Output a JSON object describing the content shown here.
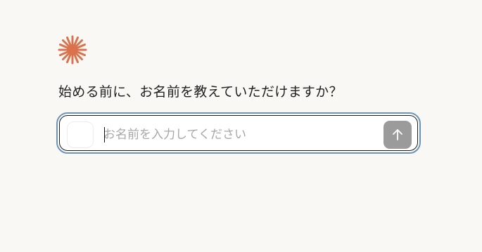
{
  "logo": {
    "icon": "asterisk-burst-icon",
    "color": "#d9734e"
  },
  "prompt": {
    "text": "始める前に、お名前を教えていただけますか？"
  },
  "name_input": {
    "placeholder": "お名前を入力してください",
    "value": ""
  },
  "send_button": {
    "icon": "arrow-up-icon",
    "color": "#9b9b9b"
  },
  "colors": {
    "background": "#faf8f5",
    "focus_ring": "#6b94b8"
  }
}
